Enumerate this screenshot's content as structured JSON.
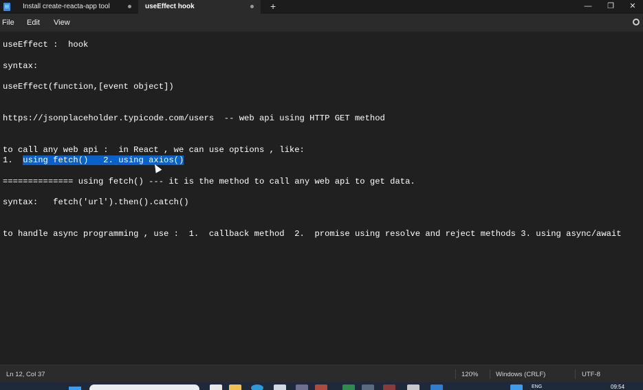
{
  "tabs": [
    {
      "label": "Install create-reacta-app tool"
    },
    {
      "label": "useEffect   hook"
    }
  ],
  "window_controls": {
    "minimize": "—",
    "maximize": "❐",
    "close": "✕",
    "new_tab": "+"
  },
  "menu": {
    "file": "File",
    "edit": "Edit",
    "view": "View"
  },
  "document": {
    "lines": [
      "useEffect :  hook",
      "syntax:",
      "useEffect(function,[event object])",
      "https://jsonplaceholder.typicode.com/users  -- web api using HTTP GET method",
      "to call any web api :  in React , we can use options , like:",
      "============== using fetch() --- it is the method to call any web api to get data.",
      "syntax:   fetch('url').then().catch()",
      "to handle async programming , use :  1.  callback method  2.  promise using resolve and reject methods 3. using async/await"
    ],
    "options_line": {
      "prefix": "1.  ",
      "selected": "using fetch()   2. using axios()"
    }
  },
  "status": {
    "position": "Ln 12, Col 37",
    "zoom": "120%",
    "line_ending": "Windows (CRLF)",
    "encoding": "UTF-8"
  },
  "taskbar": {
    "language": "ENG",
    "clock": "09:54"
  },
  "colors": {
    "background": "#202020",
    "selection": "#0a62c8",
    "chrome": "#2b2b2b"
  }
}
